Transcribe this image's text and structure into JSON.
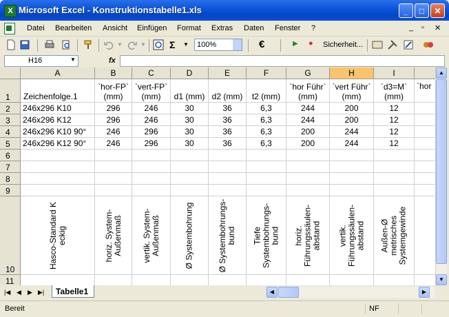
{
  "window": {
    "title": "Microsoft Excel - Konstruktionstabelle1.xls"
  },
  "menu": {
    "items": [
      "Datei",
      "Bearbeiten",
      "Ansicht",
      "Einfügen",
      "Format",
      "Extras",
      "Daten",
      "Fenster",
      "?"
    ]
  },
  "toolbar": {
    "zoom": "100%",
    "security_label": "Sicherheit...",
    "sum_symbol": "Σ",
    "euro_symbol": "€"
  },
  "formula_bar": {
    "name_box": "H16",
    "fx_label": "fx",
    "content": ""
  },
  "grid": {
    "selected_column": "H",
    "columns": [
      "A",
      "B",
      "C",
      "D",
      "E",
      "F",
      "G",
      "H",
      "I"
    ],
    "row_numbers": [
      "1",
      "2",
      "3",
      "4",
      "5",
      "6",
      "7",
      "8",
      "9",
      "10",
      "11"
    ],
    "header_row": [
      "Zeichenfolge.1",
      "`hor-FP` (mm)",
      "`vert-FP` (mm)",
      "d1 (mm)",
      "d2 (mm)",
      "t2 (mm)",
      "`hor Führ` (mm)",
      "`vert Führ` (mm)",
      "`d3=M` (mm)",
      "`hor"
    ],
    "data_rows": [
      [
        "246x296 K10",
        "296",
        "246",
        "30",
        "36",
        "6,3",
        "244",
        "200",
        "12"
      ],
      [
        "246x296 K12",
        "296",
        "246",
        "30",
        "36",
        "6,3",
        "244",
        "200",
        "12"
      ],
      [
        "246x296 K10 90°",
        "246",
        "296",
        "30",
        "36",
        "6,3",
        "200",
        "244",
        "12"
      ],
      [
        "246x296 K12 90°",
        "246",
        "296",
        "30",
        "36",
        "6,3",
        "200",
        "244",
        "12"
      ]
    ],
    "description_row": [
      "Hasco-Standard K eckig",
      "horiz. System-Außenmaß",
      "vertik. System-Außenmaß",
      "Ø Systembohrung",
      "Ø Systembohrungs-bund",
      "Tiefe Systembohrungs-bund",
      "horiz. Führungssäulen-abstand",
      "vertik. Führungssäulen-abstand",
      "Außen-Ø metrisches Systemgewinde"
    ]
  },
  "sheet_tabs": [
    "Tabelle1"
  ],
  "status": {
    "left": "Bereit",
    "nf": "NF"
  },
  "colors": {
    "title_bar": "#0a53d9",
    "selected_header": "#f9c46b",
    "excel_green": "#1e7a2e"
  }
}
